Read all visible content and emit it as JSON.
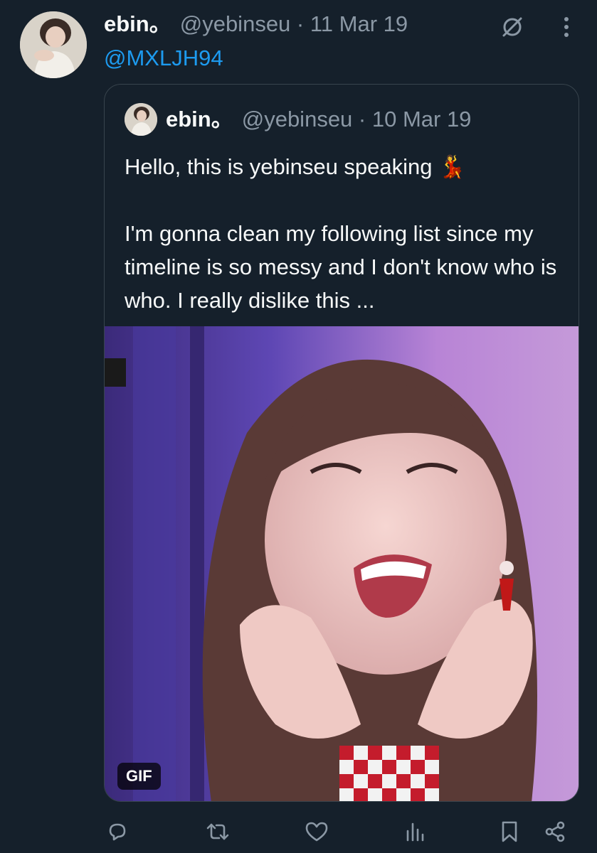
{
  "tweet": {
    "author_name": "ebin。",
    "handle_date": "@yebinseu · 11 Mar 19",
    "mention": "@MXLJH94"
  },
  "quote": {
    "author_name": "ebin。",
    "handle_date": "@yebinseu · 10 Mar 19",
    "text": "Hello, this is yebinseu speaking 💃\n\nI'm gonna clean my following list since my timeline is so messy and I don't know who is who. I really dislike this ...",
    "media_badge": "GIF"
  },
  "icons": {
    "header": [
      "grok-icon",
      "more-icon"
    ],
    "actions": [
      "reply-icon",
      "retweet-icon",
      "like-icon",
      "views-icon",
      "bookmark-icon",
      "share-icon"
    ]
  },
  "colors": {
    "background": "#15202b",
    "text_primary": "#f7f9f9",
    "text_secondary": "#8b98a5",
    "accent": "#1d9bf0",
    "border": "#38444d"
  }
}
